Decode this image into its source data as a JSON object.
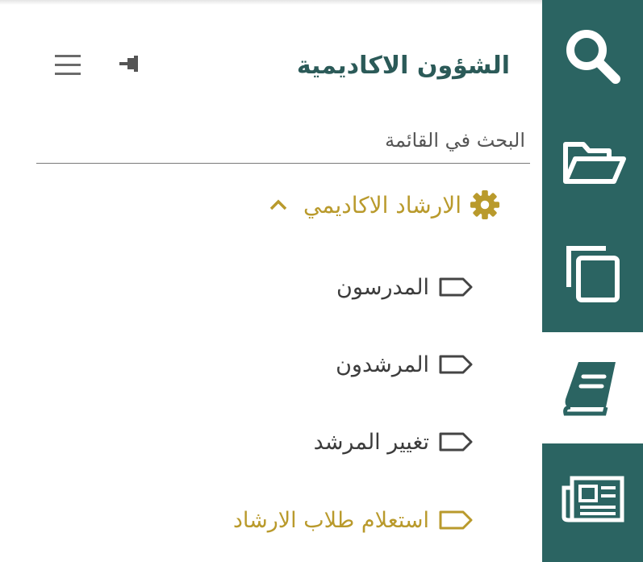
{
  "sidebar": {
    "title": "الشؤون الاكاديمية",
    "search_placeholder": "البحث في القائمة",
    "group": {
      "label": "الارشاد الاكاديمي",
      "icon": "gear-icon",
      "expanded": true,
      "items": [
        {
          "label": "المدرسون",
          "icon": "tag-outline-icon",
          "active": false
        },
        {
          "label": "المرشدون",
          "icon": "tag-outline-icon",
          "active": false
        },
        {
          "label": "تغيير المرشد",
          "icon": "tag-outline-icon",
          "active": false
        },
        {
          "label": "استعلام طلاب الارشاد",
          "icon": "tag-outline-icon",
          "active": true
        }
      ]
    }
  },
  "rail": {
    "buttons": [
      {
        "icon": "search-icon",
        "active": false
      },
      {
        "icon": "folder-open-icon",
        "active": false
      },
      {
        "icon": "copy-icon",
        "active": false
      },
      {
        "icon": "book-icon",
        "active": true
      },
      {
        "icon": "newspaper-icon",
        "active": false
      }
    ]
  },
  "colors": {
    "rail": "#2b6462",
    "title": "#2b5a58",
    "accent": "#b99a2c",
    "text": "#3c3c3c"
  }
}
